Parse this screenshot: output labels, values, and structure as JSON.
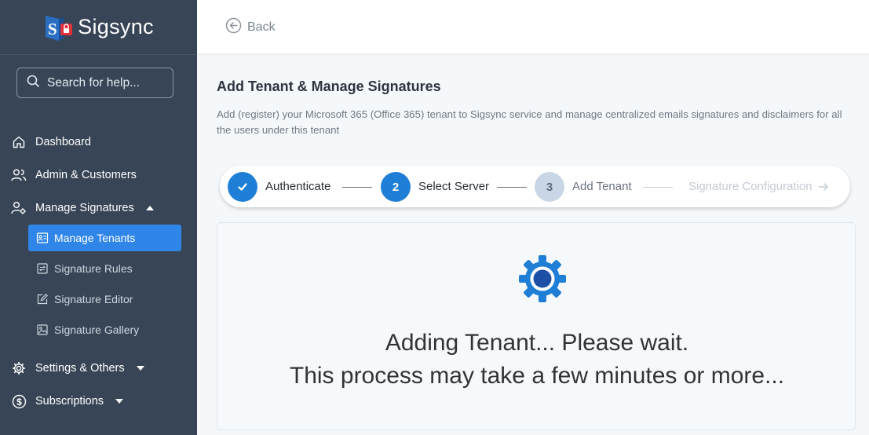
{
  "brand": {
    "name": "Sigsync"
  },
  "search": {
    "placeholder": "Search for help..."
  },
  "sidebar": {
    "items": [
      {
        "label": "Dashboard",
        "icon": "home-icon"
      },
      {
        "label": "Admin & Customers",
        "icon": "users-icon"
      },
      {
        "label": "Manage Signatures",
        "icon": "user-gear-icon",
        "expanded": true
      },
      {
        "label": "Settings & Others",
        "icon": "gear-icon"
      },
      {
        "label": "Subscriptions",
        "icon": "dollar-icon"
      }
    ],
    "sub_items": [
      {
        "label": "Manage Tenants",
        "icon": "tenants-icon",
        "active": true
      },
      {
        "label": "Signature Rules",
        "icon": "rules-icon"
      },
      {
        "label": "Signature Editor",
        "icon": "edit-icon"
      },
      {
        "label": "Signature Gallery",
        "icon": "gallery-icon"
      }
    ]
  },
  "topbar": {
    "back_label": "Back"
  },
  "page": {
    "title": "Add Tenant & Manage Signatures",
    "description": "Add (register) your Microsoft 365 (Office 365) tenant to Sigsync service and manage centralized emails signatures and disclaimers for all the users under this tenant"
  },
  "stepper": {
    "steps": [
      {
        "number": "",
        "label": "Authenticate",
        "state": "completed"
      },
      {
        "number": "2",
        "label": "Select Server",
        "state": "active"
      },
      {
        "number": "3",
        "label": "Add Tenant",
        "state": "pending"
      },
      {
        "number": "",
        "label": "Signature Configuration",
        "state": "disabled"
      }
    ]
  },
  "status": {
    "line1": "Adding Tenant... Please wait.",
    "line2": "This process may take a few minutes or more..."
  },
  "colors": {
    "sidebar_bg": "#374556",
    "accent": "#2f86e8",
    "step_active": "#1f7fd6",
    "step_pending": "#c9d6e6",
    "gear": "#1f7fd6"
  }
}
